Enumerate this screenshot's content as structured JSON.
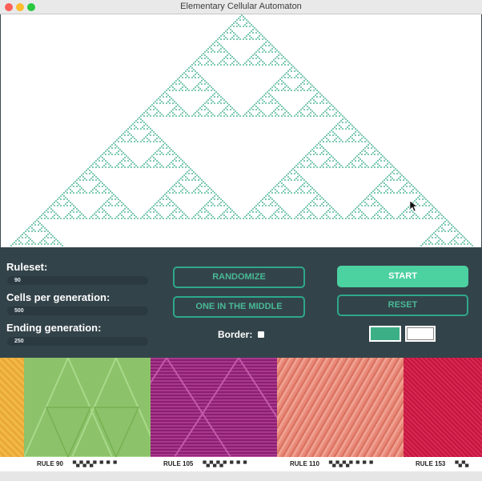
{
  "window": {
    "title": "Elementary Cellular Automaton"
  },
  "colors": {
    "cell": "#7fc9b3",
    "panel": "#33434a",
    "accent": "#4cd1a1",
    "swatch_active": "#3daf86"
  },
  "controls": {
    "ruleset": {
      "label": "Ruleset:",
      "value": "90"
    },
    "cells": {
      "label": "Cells per generation:",
      "value": "500"
    },
    "ending": {
      "label": "Ending generation:",
      "value": "250"
    },
    "randomize_label": "RANDOMIZE",
    "middle_label": "ONE IN THE MIDDLE",
    "start_label": "START",
    "reset_label": "RESET",
    "border_label": "Border:"
  },
  "gallery": [
    {
      "caption": "RULE 90",
      "pattern": "▀▄▀▄▀▄▀ ▀ ▀ ▀"
    },
    {
      "caption": "RULE 105",
      "pattern": "▀▄▀▄▀▄▀ ▀ ▀ ▀"
    },
    {
      "caption": "RULE 110",
      "pattern": "▀▄▀▄▀▄▀ ▀ ▀ ▀"
    },
    {
      "caption": "RULE 153",
      "pattern": "▀▄▀▄"
    }
  ]
}
